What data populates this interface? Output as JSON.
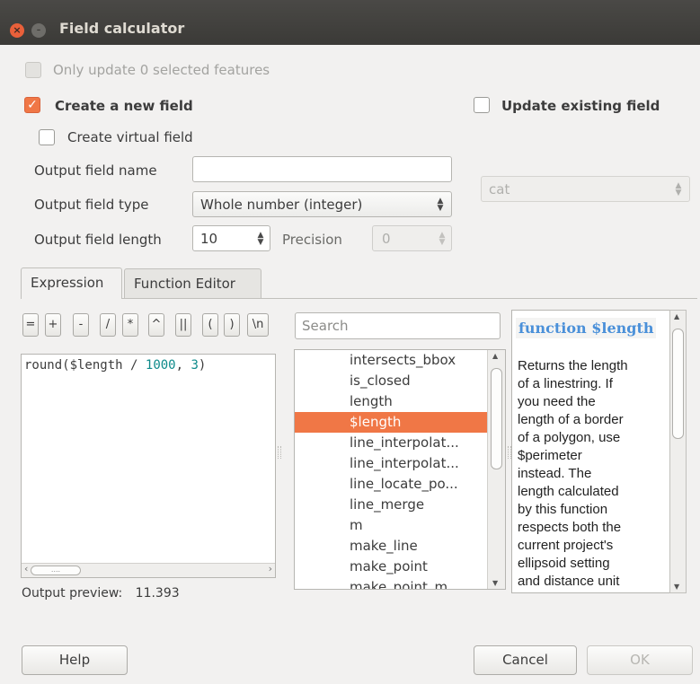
{
  "window": {
    "title": "Field calculator",
    "close_glyph": "×",
    "minimize_glyph": "–"
  },
  "options": {
    "only_update_label": "Only update 0 selected features",
    "create_new_label": "Create a new field",
    "update_existing_label": "Update existing field",
    "create_virtual_label": "Create virtual field"
  },
  "fields": {
    "output_name_label": "Output field name",
    "output_name_value": "",
    "output_type_label": "Output field type",
    "output_type_value": "Whole number (integer)",
    "output_length_label": "Output field length",
    "output_length_value": "10",
    "precision_label": "Precision",
    "precision_value": "0",
    "existing_field_value": "cat"
  },
  "tabs": [
    {
      "label": "Expression"
    },
    {
      "label": "Function Editor"
    }
  ],
  "operators": [
    "=",
    "+",
    "-",
    "/",
    "*",
    "^",
    "||",
    "(",
    ")",
    "\\n"
  ],
  "expression": {
    "func": "round(",
    "var": "$length",
    "op": " / ",
    "num1": "1000",
    "sep": ", ",
    "num2": "3",
    "close": ")"
  },
  "search": {
    "placeholder": "Search"
  },
  "function_list": [
    "intersects_bbox",
    "is_closed",
    "length",
    "$length",
    "line_interpolat...",
    "line_interpolat...",
    "line_locate_po...",
    "line_merge",
    "m",
    "make_line",
    "make_point",
    "make_point_m"
  ],
  "selected_function": "$length",
  "help": {
    "title": "function $length",
    "lines": [
      "Returns the length",
      "of a linestring. If",
      "you need the",
      "length of a border",
      "of a polygon, use",
      "$perimeter",
      "instead. The",
      "length calculated",
      "by this function",
      "respects both the",
      "current project's",
      "ellipsoid setting",
      "and distance unit"
    ]
  },
  "preview": {
    "label": "Output preview:",
    "value": "11.393"
  },
  "buttons": {
    "help": "Help",
    "cancel": "Cancel",
    "ok": "OK"
  },
  "hscroll": {
    "thumb_glyph": "....",
    "left_arrow": "‹",
    "right_arrow": "›"
  },
  "colors": {
    "accent": "#f07746",
    "titlebar": "#3c3b37",
    "help_title": "#4a90d9",
    "number": "#0d8a8a"
  }
}
